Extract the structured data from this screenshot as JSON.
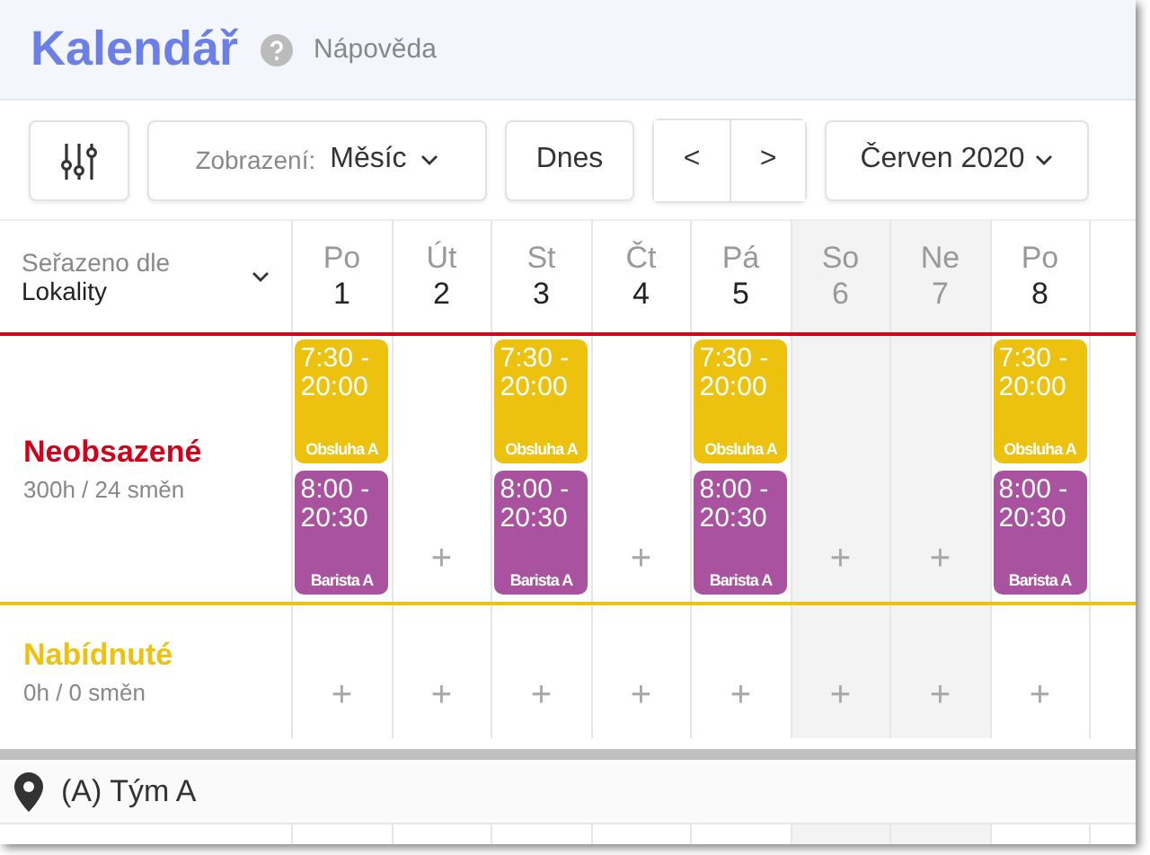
{
  "title": "Kalendář",
  "help": "Nápověda",
  "toolbar": {
    "view_label": "Zobrazení:",
    "view_value": "Měsíc",
    "today": "Dnes",
    "prev": "<",
    "next": ">",
    "period": "Červen 2020"
  },
  "sort": {
    "label": "Seřazeno dle",
    "value": "Lokality"
  },
  "days": [
    {
      "weekday": "Po",
      "date": "1",
      "weekend": false
    },
    {
      "weekday": "Út",
      "date": "2",
      "weekend": false
    },
    {
      "weekday": "St",
      "date": "3",
      "weekend": false
    },
    {
      "weekday": "Čt",
      "date": "4",
      "weekend": false
    },
    {
      "weekday": "Pá",
      "date": "5",
      "weekend": false
    },
    {
      "weekday": "So",
      "date": "6",
      "weekend": true
    },
    {
      "weekday": "Ne",
      "date": "7",
      "weekend": true
    },
    {
      "weekday": "Po",
      "date": "8",
      "weekend": false
    }
  ],
  "rows": [
    {
      "title": "Neobsazené",
      "summary": "300h / 24 směn",
      "color": "#d0021b",
      "cells": [
        [
          {
            "time": "7:30 - 20:00",
            "role": "Obsluha A",
            "color": "#ecc20f"
          },
          {
            "time": "8:00 - 20:30",
            "role": "Barista A",
            "color": "#a9529f"
          }
        ],
        [],
        [
          {
            "time": "7:30 - 20:00",
            "role": "Obsluha A",
            "color": "#ecc20f"
          },
          {
            "time": "8:00 - 20:30",
            "role": "Barista A",
            "color": "#a9529f"
          }
        ],
        [],
        [
          {
            "time": "7:30 - 20:00",
            "role": "Obsluha A",
            "color": "#ecc20f"
          },
          {
            "time": "8:00 - 20:30",
            "role": "Barista A",
            "color": "#a9529f"
          }
        ],
        [],
        [],
        [
          {
            "time": "7:30 - 20:00",
            "role": "Obsluha A",
            "color": "#ecc20f"
          },
          {
            "time": "8:00 - 20:30",
            "role": "Barista A",
            "color": "#a9529f"
          }
        ]
      ]
    },
    {
      "title": "Nabídnuté",
      "summary": "0h / 0 směn",
      "color": "#ecc20f",
      "cells": [
        [],
        [],
        [],
        [],
        [],
        [],
        [],
        []
      ]
    }
  ],
  "add_sign": "+",
  "location": "(A) Tým A"
}
